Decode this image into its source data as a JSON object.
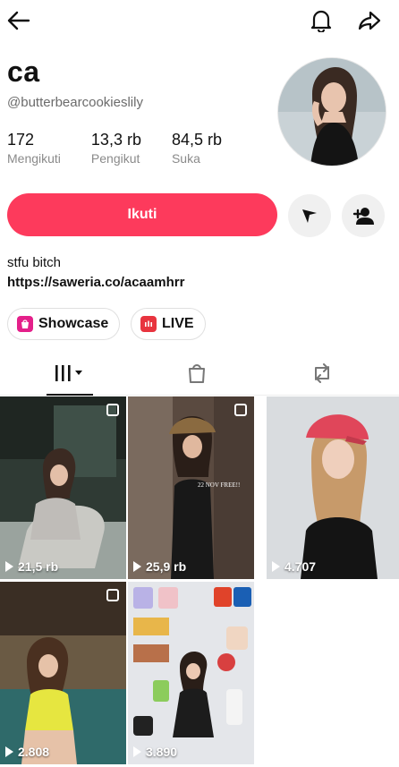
{
  "header": {
    "back_icon": "arrow-left-icon",
    "bell_icon": "bell-icon",
    "share_icon": "share-arrow-icon"
  },
  "profile": {
    "display_name": "ca",
    "username": "@butterbearcookieslily",
    "stats": [
      {
        "value": "172",
        "label": "Mengikuti"
      },
      {
        "value": "13,3 rb",
        "label": "Pengikut"
      },
      {
        "value": "84,5 rb",
        "label": "Suka"
      }
    ],
    "follow_label": "Ikuti",
    "bio": "stfu bitch",
    "link": "https://saweria.co/acaamhrr"
  },
  "pills": {
    "showcase": "Showcase",
    "live": "LIVE"
  },
  "colors": {
    "accent": "#fd3a5c",
    "showcase_icon": "#e4208a",
    "live_icon": "#e8343f"
  },
  "grid": {
    "videos": [
      {
        "views": "21,5 rb"
      },
      {
        "views": "25,9 rb",
        "overlay": "22 NOV FREE!!"
      },
      {
        "views": "4.707"
      },
      {
        "views": "2.808"
      },
      {
        "views": "3.890"
      }
    ]
  }
}
